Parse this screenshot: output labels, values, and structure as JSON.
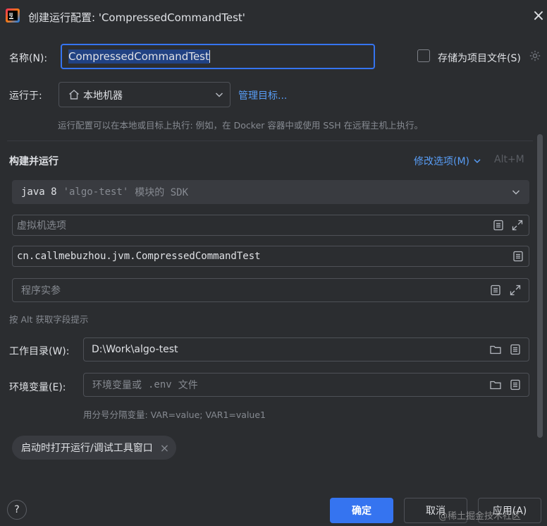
{
  "window": {
    "title": "创建运行配置: 'CompressedCommandTest'",
    "close_glyph": "×"
  },
  "name_row": {
    "label": "名称(N):",
    "value": "CompressedCommandTest"
  },
  "store_as_file": {
    "label": "存储为项目文件(S)",
    "checked": false
  },
  "run_on": {
    "label": "运行于:",
    "value": "本地机器",
    "manage_link": "管理目标...",
    "hint": "运行配置可以在本地或目标上执行: 例如，在 Docker 容器中或使用 SSH 在远程主机上执行。"
  },
  "build_run": {
    "title": "构建并运行",
    "modify_options": "修改选项(M)",
    "shortcut": "Alt+M",
    "sdk": {
      "version": "java 8",
      "module": "'algo-test'",
      "suffix": "模块的 SDK"
    },
    "vm_options_placeholder": "虚拟机选项",
    "main_class": "cn.callmebuzhou.jvm.CompressedCommandTest",
    "program_args_placeholder": "程序实参",
    "alt_hint": "按 Alt 获取字段提示"
  },
  "working_dir": {
    "label": "工作目录(W):",
    "value": "D:\\Work\\algo-test"
  },
  "env_vars": {
    "label": "环境变量(E):",
    "placeholder_text": "环境变量或",
    "placeholder_mono": ".env",
    "placeholder_suffix": "文件",
    "hint": "用分号分隔变量: VAR=value; VAR1=value1"
  },
  "tag_chip": {
    "label": "启动时打开运行/调试工具窗口",
    "remove_glyph": "×"
  },
  "footer": {
    "help": "?",
    "ok": "确定",
    "cancel": "取消",
    "apply": "应用(A)"
  },
  "watermark": "@稀土掘金技术社区",
  "colors": {
    "accent": "#3574f0",
    "background": "#2b2d30",
    "link": "#589df6"
  }
}
